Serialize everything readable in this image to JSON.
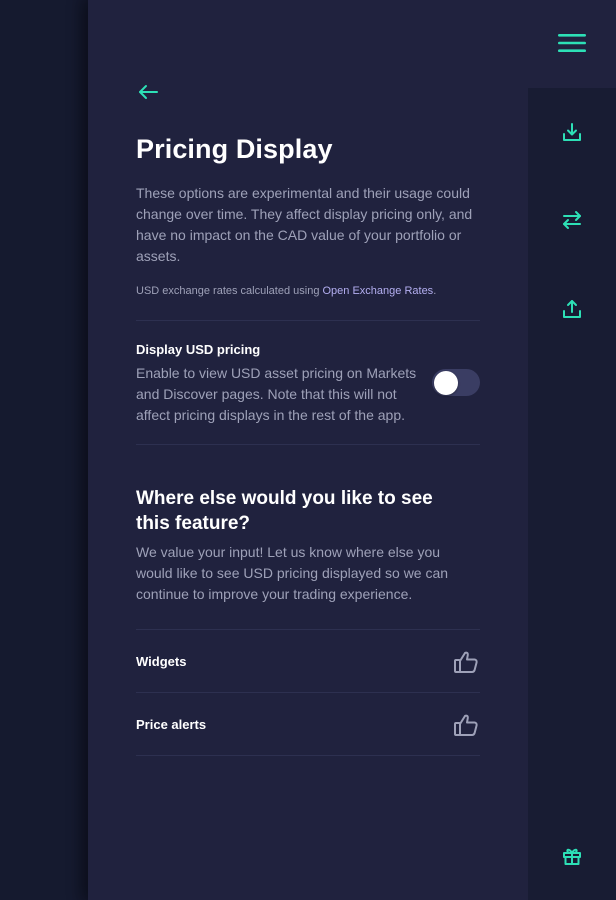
{
  "page": {
    "title": "Pricing Display",
    "intro": "These options are experimental and their usage could change over time. They affect display pricing only, and have no impact on the CAD value of your portfolio or assets.",
    "rates_note_prefix": "USD exchange rates calculated using ",
    "rates_link": "Open Exchange Rates",
    "rates_note_suffix": "."
  },
  "setting": {
    "title": "Display USD pricing",
    "description": "Enable to view USD asset pricing on Markets and Discover pages. Note that this will not affect pricing displays in the rest of the app.",
    "enabled": false
  },
  "feedback": {
    "title": "Where else would you like to see this feature?",
    "description": "We value your input! Let us know where else you would like to see USD pricing displayed so we can continue to improve your trading experience.",
    "items": [
      {
        "label": "Widgets",
        "icon": "thumbs-up-icon"
      },
      {
        "label": "Price alerts",
        "icon": "thumbs-up-icon"
      }
    ]
  },
  "rail": {
    "icons": [
      "menu-icon",
      "receive-icon",
      "transfer-icon",
      "send-icon",
      "gift-icon"
    ]
  },
  "colors": {
    "accent": "#2de0b6",
    "panel": "#20223e",
    "rail": "#181c33",
    "text_muted": "#9ea1b8",
    "link": "#b3aef0"
  }
}
